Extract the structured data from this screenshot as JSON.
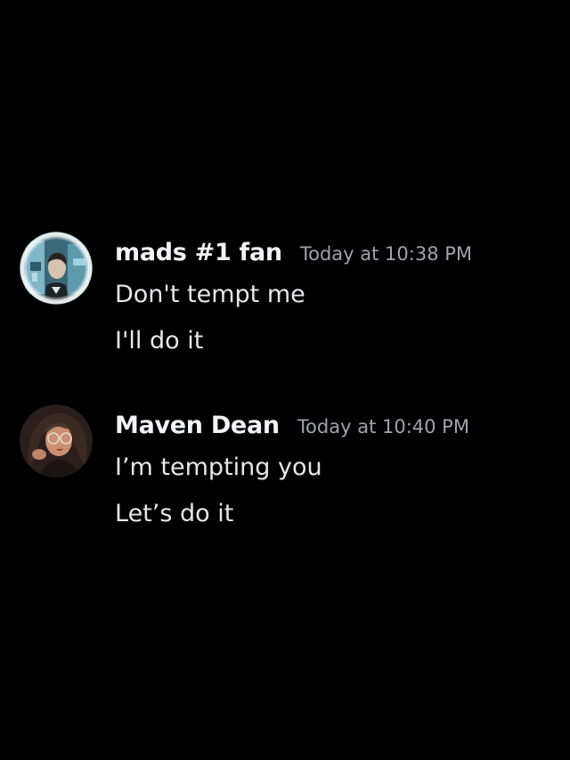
{
  "messages": [
    {
      "username": "mads #1 fan",
      "timestamp": "Today at 10:38 PM",
      "avatar_icon": "user-avatar-man-photo",
      "lines": [
        "Don't tempt me",
        "I'll do it"
      ]
    },
    {
      "username": "Maven Dean",
      "timestamp": "Today at 10:40 PM",
      "avatar_icon": "user-avatar-illustrated-woman",
      "lines": [
        "I’m tempting you",
        "Let’s do it"
      ]
    }
  ],
  "colors": {
    "background": "#000000",
    "username": "#f2f3f5",
    "timestamp": "#a0a3aa",
    "message_text": "#e6e7e9"
  }
}
